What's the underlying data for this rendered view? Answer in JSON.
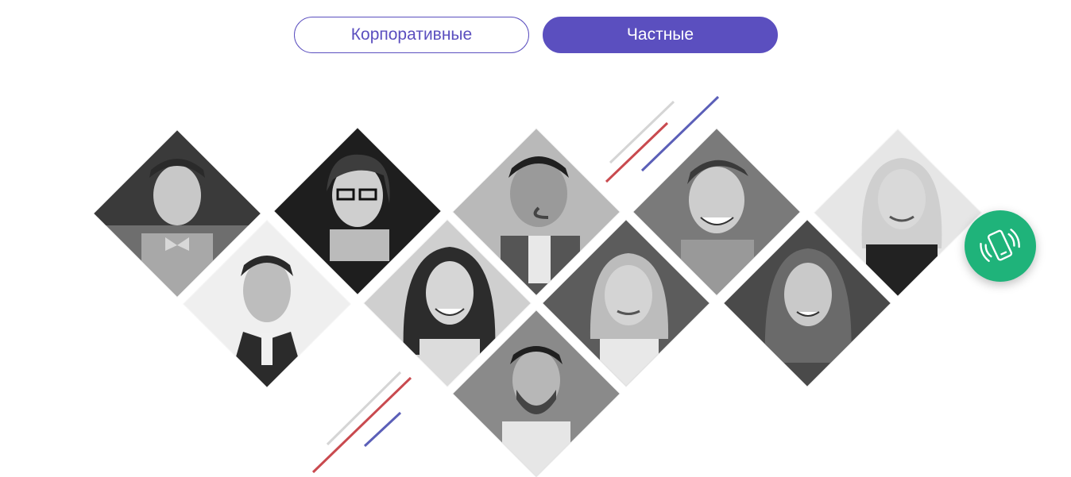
{
  "tabs": [
    {
      "label": "Корпоративные",
      "active": false
    },
    {
      "label": "Частные",
      "active": true
    }
  ],
  "portraits": [
    {
      "name": "man-bowtie"
    },
    {
      "name": "woman-glasses"
    },
    {
      "name": "man-smiling-suit"
    },
    {
      "name": "young-man-laughing"
    },
    {
      "name": "blonde-woman"
    },
    {
      "name": "man-jacket"
    },
    {
      "name": "woman-smiling"
    },
    {
      "name": "woman-blonde-outdoor"
    },
    {
      "name": "woman-long-hair"
    },
    {
      "name": "man-beard"
    }
  ],
  "colors": {
    "accent": "#5b4fbf",
    "call": "#1fb37a",
    "line_red": "#c94a4f",
    "line_blue": "#5b5fb8",
    "line_grey": "#d3d3d3"
  },
  "call_button": {
    "icon": "phone-vibrate-icon"
  }
}
